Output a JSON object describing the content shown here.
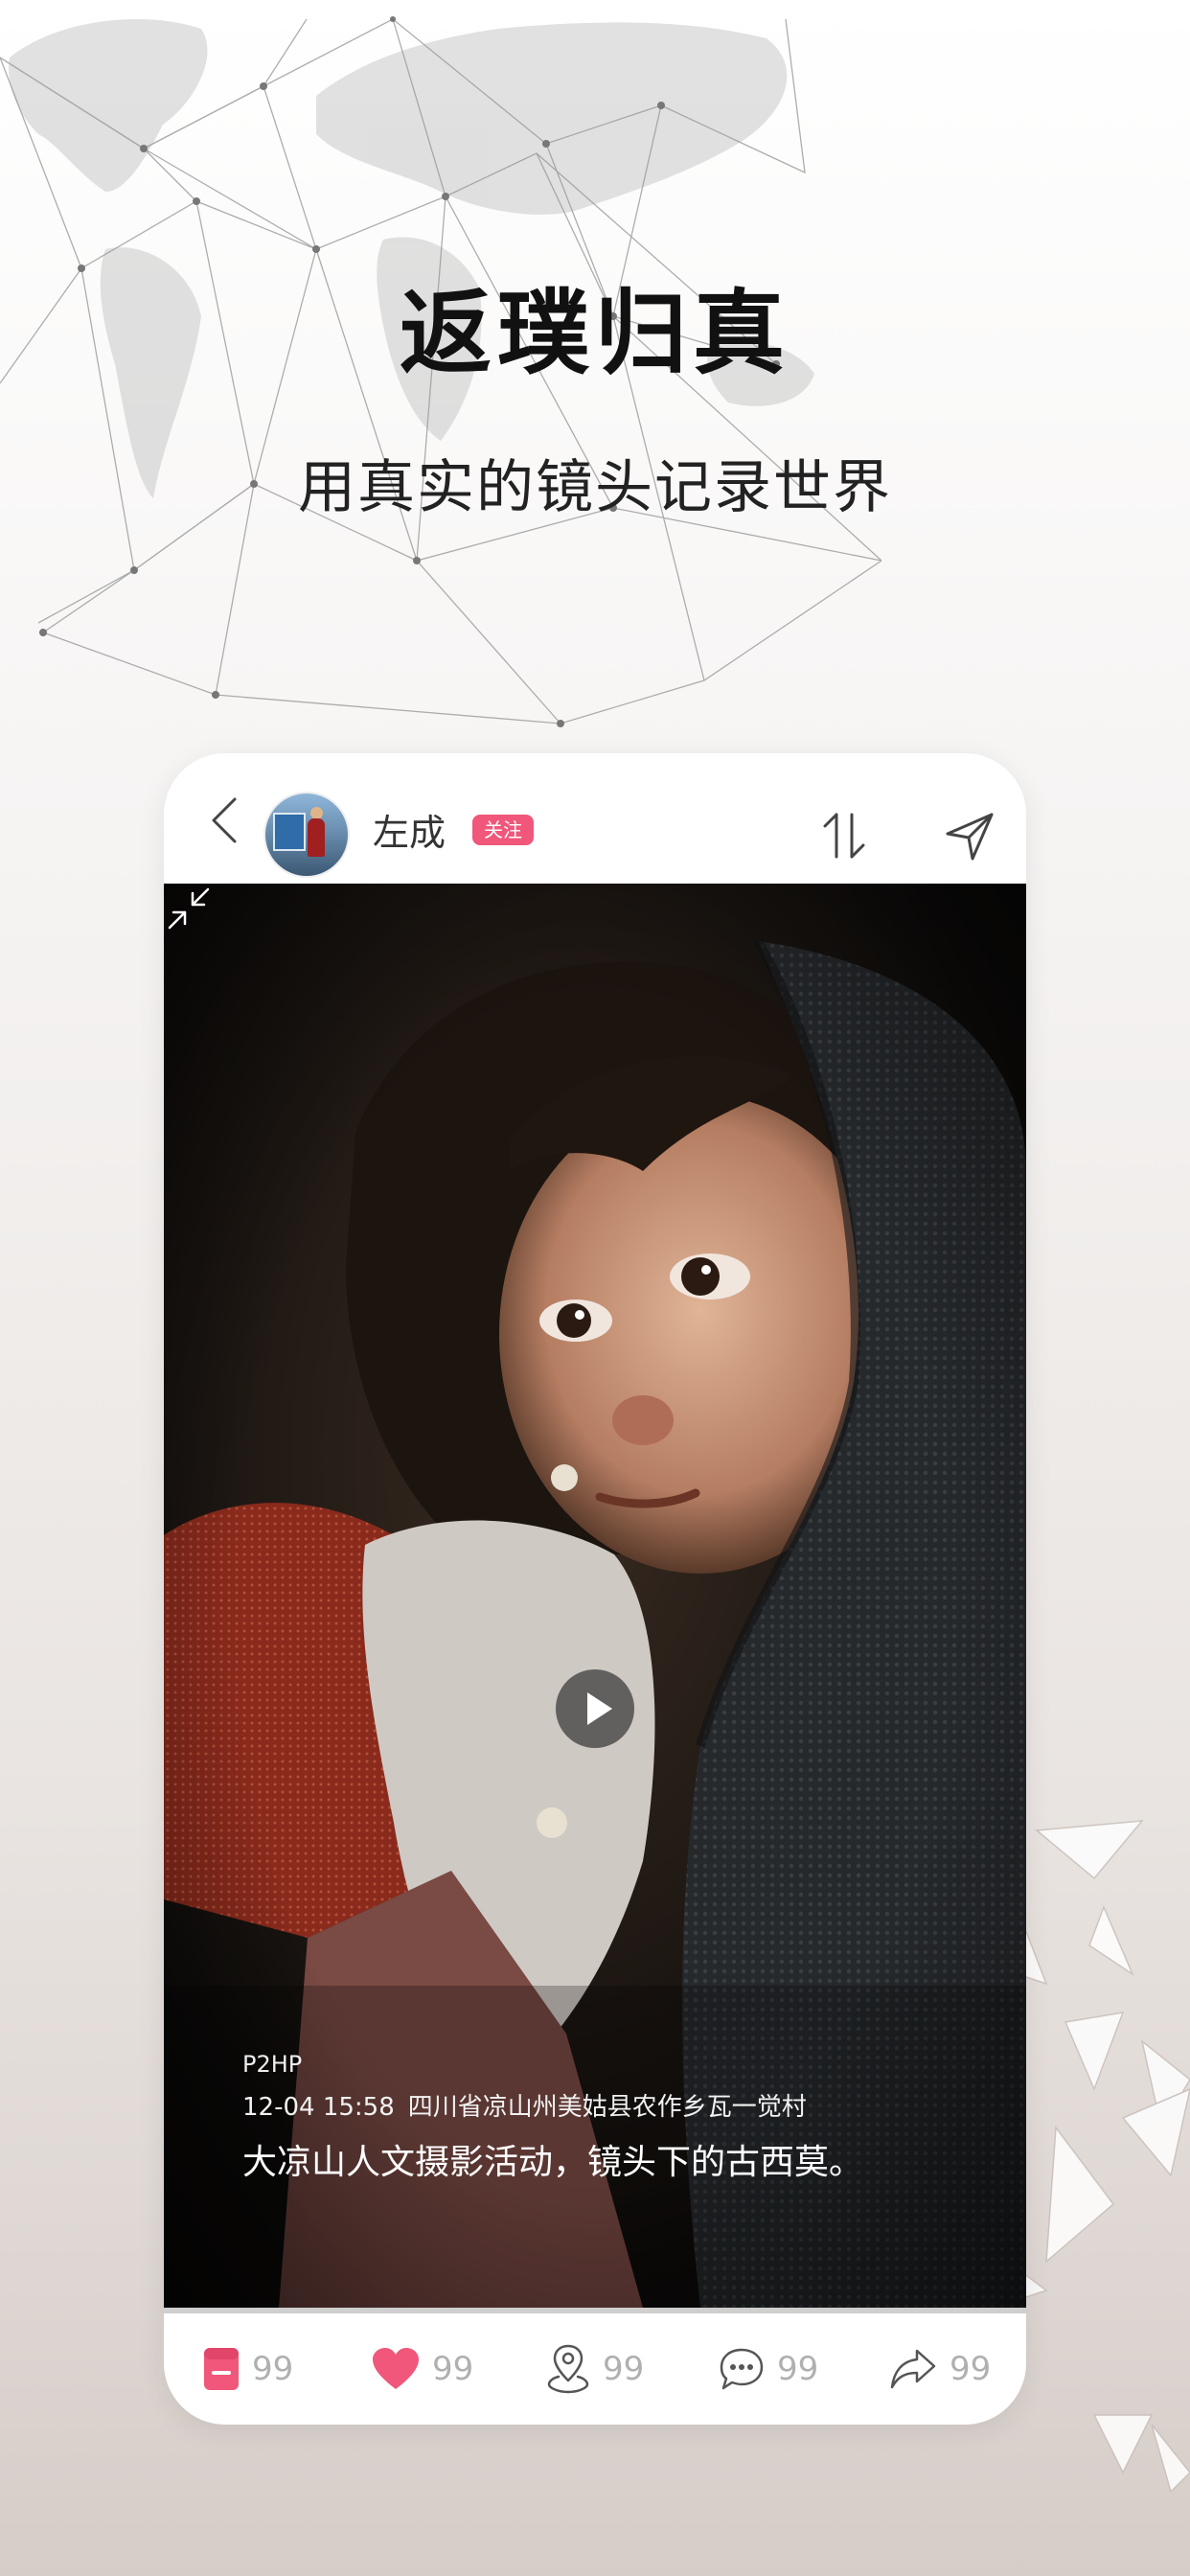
{
  "hero": {
    "headline": "返璞归真",
    "subtitle": "用真实的镜头记录世界"
  },
  "header": {
    "username": "左成",
    "follow_label": "关注"
  },
  "post": {
    "source": "P2HP",
    "timestamp": "12-04 15:58",
    "location": "四川省凉山州美姑县农作乡瓦一觉村",
    "description": "大凉山人文摄影活动，镜头下的古西莫。",
    "progress": 0
  },
  "actions": {
    "save_count": "99",
    "like_count": "99",
    "location_count": "99",
    "comment_count": "99",
    "share_count": "99"
  },
  "colors": {
    "accent": "#f0577b",
    "icon": "#555555",
    "count": "#b0b0b0"
  }
}
